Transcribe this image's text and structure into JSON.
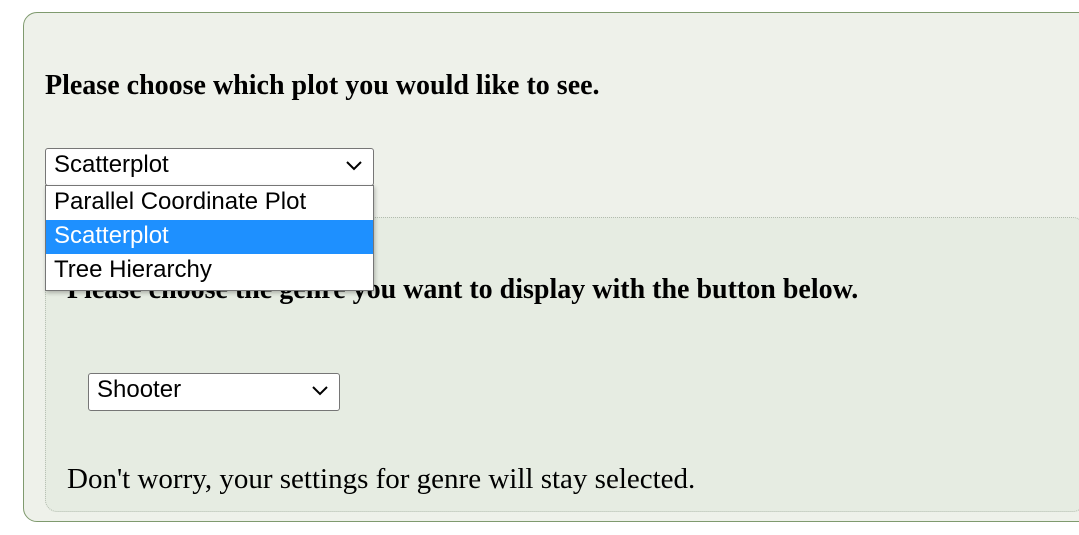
{
  "plot_section": {
    "heading": "Please choose which plot you would like to see.",
    "selected_value": "Scatterplot",
    "options": [
      {
        "label": "Parallel Coordinate Plot",
        "selected": false
      },
      {
        "label": "Scatterplot",
        "selected": true
      },
      {
        "label": "Tree Hierarchy",
        "selected": false
      }
    ],
    "dropdown_open": true
  },
  "genre_section": {
    "heading": "Please choose the genre you want to display with the button below.",
    "selected_value": "Shooter",
    "note": "Don't worry, your settings for genre will stay selected."
  },
  "colors": {
    "outer_panel_bg": "#eef1ea",
    "inner_panel_bg": "#e6ece2",
    "panel_border": "#7f9a6e",
    "highlight": "#1e90ff"
  },
  "icons": {
    "select_arrow": "chevron-down-icon"
  }
}
